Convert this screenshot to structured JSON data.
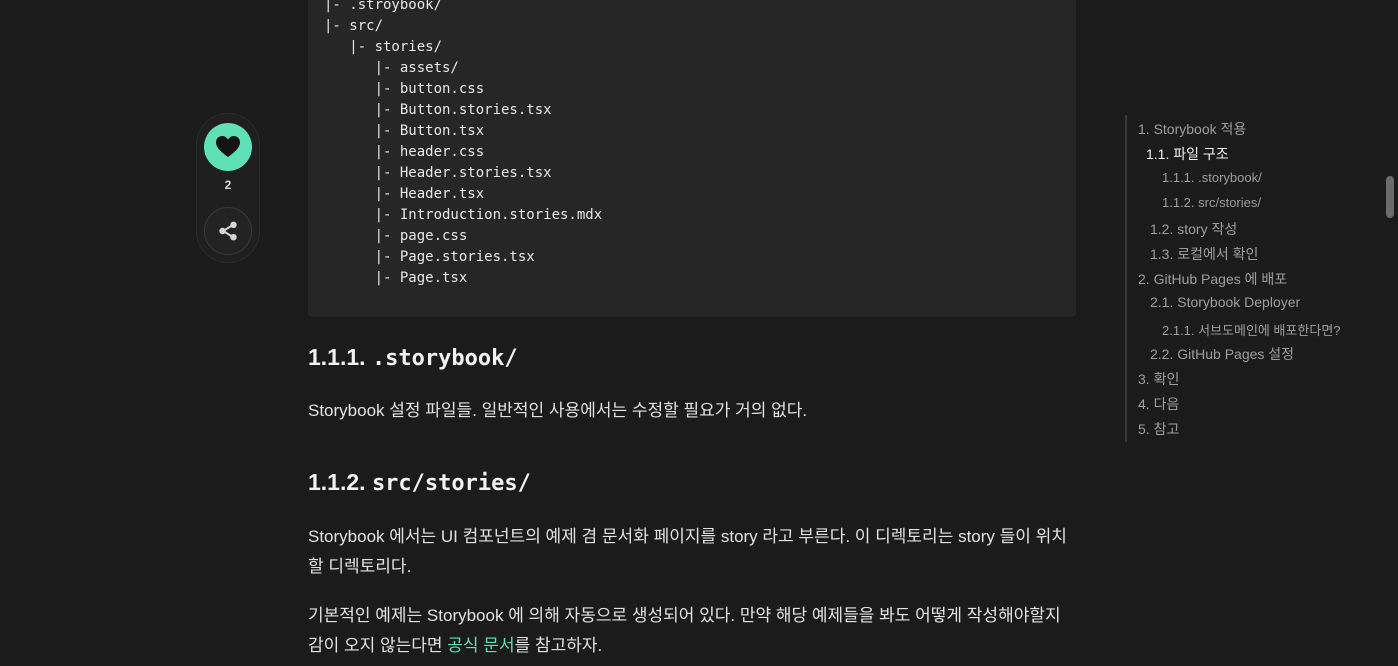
{
  "code_lines": [
    "|- .stroybook/",
    "|- src/",
    "   |- stories/",
    "      |- assets/",
    "      |- button.css",
    "      |- Button.stories.tsx",
    "      |- Button.tsx",
    "      |- header.css",
    "      |- Header.stories.tsx",
    "      |- Header.tsx",
    "      |- Introduction.stories.mdx",
    "      |- page.css",
    "      |- Page.stories.tsx",
    "      |- Page.tsx"
  ],
  "like_count": "2",
  "section_1": {
    "number": "1.1.1.",
    "code": ".storybook/"
  },
  "para_1": "Storybook 설정 파일들. 일반적인 사용에서는 수정할 필요가 거의 없다.",
  "section_2": {
    "number": "1.1.2.",
    "code": "src/stories/"
  },
  "para_2": "Storybook 에서는 UI 컴포넌트의 예제 겸 문서화 페이지를 story 라고 부른다. 이 디렉토리는 story 들이 위치할 디렉토리다.",
  "para_3": {
    "before": "기본적인 예제는 Storybook 에 의해 자동으로 생성되어 있다. 만약 해당 예제들을 봐도 어떻게 작성해야할지 감이 오지 않는다면 ",
    "link": "공식 문서",
    "after": "를 참고하자."
  },
  "toc": [
    {
      "label": "1. Storybook 적용"
    },
    {
      "label": "1.1. 파일 구조"
    },
    {
      "label": "1.1.1. .storybook/"
    },
    {
      "label": "1.1.2. src/stories/"
    },
    {
      "label": "1.2. story 작성"
    },
    {
      "label": "1.3. 로컬에서 확인"
    },
    {
      "label": "2. GitHub Pages 에 배포"
    },
    {
      "label": "2.1. Storybook Deployer"
    },
    {
      "label": "2.1.1. 서브도메인에 배포한다면?"
    },
    {
      "label": "2.2. GitHub Pages 설정"
    },
    {
      "label": "3. 확인"
    },
    {
      "label": "4. 다음"
    },
    {
      "label": "5. 참고"
    }
  ],
  "colors": {
    "background": "#1b1b1b",
    "code_background": "#262626",
    "accent": "#5fe0b7",
    "toc_text": "#9e9e9e"
  },
  "icons": {
    "like": "heart-icon",
    "share": "share-icon"
  }
}
